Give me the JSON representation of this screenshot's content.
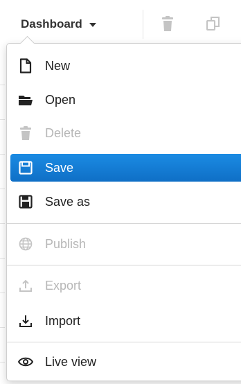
{
  "toolbar": {
    "dashboard_label": "Dashboard"
  },
  "menu": {
    "items": [
      {
        "label": "New",
        "icon": "file-icon",
        "enabled": true
      },
      {
        "label": "Open",
        "icon": "folder-open-icon",
        "enabled": true
      },
      {
        "label": "Delete",
        "icon": "trash-icon",
        "enabled": false
      },
      {
        "label": "Save",
        "icon": "floppy-icon",
        "enabled": true,
        "highlighted": true
      },
      {
        "label": "Save as",
        "icon": "save-as-icon",
        "enabled": true
      },
      {
        "label": "Publish",
        "icon": "globe-icon",
        "enabled": false
      },
      {
        "label": "Export",
        "icon": "upload-icon",
        "enabled": false
      },
      {
        "label": "Import",
        "icon": "download-icon",
        "enabled": true
      },
      {
        "label": "Live view",
        "icon": "eye-icon",
        "enabled": true
      }
    ]
  },
  "colors": {
    "highlight": "#1578d6",
    "disabled_text": "#b7b7b7",
    "text": "#222222"
  }
}
